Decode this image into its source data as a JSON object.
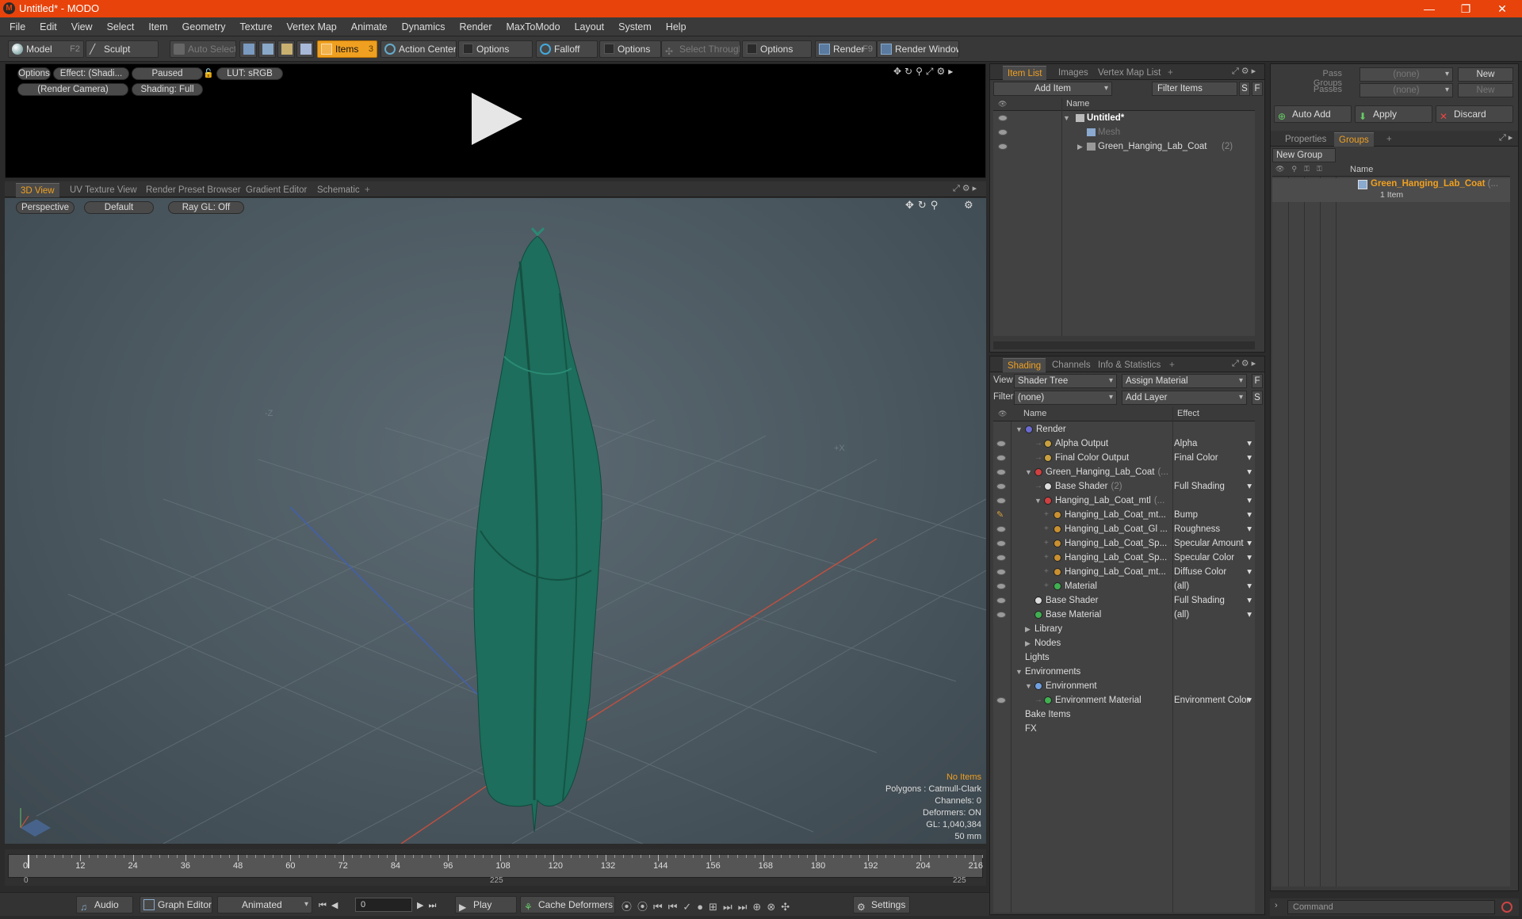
{
  "app": {
    "logo": "M",
    "title": "Untitled* - MODO",
    "min": "—",
    "max": "❐",
    "close": "✕"
  },
  "menu": [
    "File",
    "Edit",
    "View",
    "Select",
    "Item",
    "Geometry",
    "Texture",
    "Vertex Map",
    "Animate",
    "Dynamics",
    "Render",
    "MaxToModo",
    "Layout",
    "System",
    "Help"
  ],
  "toolbar": {
    "model": "Model",
    "model_key": "F2",
    "sculpt": "Sculpt",
    "auto_select": "Auto Select",
    "items": "Items",
    "items_key": "3",
    "action_center": "Action Center",
    "options1": "Options",
    "falloff": "Falloff",
    "options2": "Options",
    "select_through": "Select Through",
    "options3": "Options",
    "render": "Render",
    "render_key": "F9",
    "render_window": "Render Window"
  },
  "preview": {
    "options": "Options",
    "effect": "Effect: (Shadi...",
    "paused": "Paused",
    "lut": "LUT: sRGB",
    "camera": "(Render Camera)",
    "shading": "Shading: Full"
  },
  "viewtabs": [
    "3D View",
    "UV Texture View",
    "Render Preset Browser",
    "Gradient Editor",
    "Schematic"
  ],
  "viewport": {
    "perspective": "Perspective",
    "default": "Default",
    "raygl": "Ray GL: Off",
    "axis_z": "-Z",
    "axis_x": "+X",
    "info": {
      "no_items": "No Items",
      "polygons": "Polygons : Catmull-Clark",
      "channels": "Channels: 0",
      "deformers": "Deformers: ON",
      "gl": "GL: 1,040,384",
      "focal": "50 mm"
    }
  },
  "timeline": {
    "ticks": [
      "0",
      "12",
      "24",
      "36",
      "48",
      "60",
      "72",
      "84",
      "96",
      "108",
      "120",
      "132",
      "144",
      "156",
      "168",
      "180",
      "192",
      "204",
      "216"
    ],
    "start": "0",
    "mid": "225",
    "end": "225"
  },
  "bottombar": {
    "audio": "Audio",
    "graph_editor": "Graph Editor",
    "animated": "Animated",
    "frame": "0",
    "play": "Play",
    "cache_deformers": "Cache Deformers",
    "settings": "Settings"
  },
  "itemlist": {
    "tabs": [
      "Item List",
      "Images",
      "Vertex Map List"
    ],
    "add_item": "Add Item",
    "filter_items": "Filter Items",
    "s": "S",
    "f": "F",
    "col_name": "Name",
    "rows": [
      {
        "name": "Untitled*",
        "level": 0,
        "bold": true,
        "eye": true
      },
      {
        "name": "Mesh",
        "level": 1,
        "dim": true,
        "eye": true
      },
      {
        "name": "Green_Hanging_Lab_Coat",
        "count": "(2)",
        "level": 1,
        "eye": true
      }
    ]
  },
  "shading": {
    "tabs": [
      "Shading",
      "Channels",
      "Info & Statistics"
    ],
    "view_label": "View",
    "view_value": "Shader Tree",
    "assign_material": "Assign Material",
    "f": "F",
    "filter_label": "Filter",
    "filter_value": "(none)",
    "add_layer": "Add Layer",
    "s": "S",
    "col_name": "Name",
    "col_effect": "Effect",
    "rows": [
      {
        "name": "Render",
        "indent": 0,
        "icon": "#6a6ad0",
        "effect": "",
        "eye": false,
        "exp": "▼"
      },
      {
        "name": "Alpha Output",
        "indent": 2,
        "icon": "#c8a040",
        "effect": "Alpha",
        "eye": true,
        "arr": true
      },
      {
        "name": "Final Color Output",
        "indent": 2,
        "icon": "#c8a040",
        "effect": "Final Color",
        "eye": true,
        "arr": true
      },
      {
        "name": "Green_Hanging_Lab_Coat",
        "suffix": "(...",
        "indent": 1,
        "icon": "#d04040",
        "effect": "",
        "eye": true,
        "exp": "▼",
        "arr": true
      },
      {
        "name": "Base Shader",
        "suffix": "(2)",
        "indent": 2,
        "icon": "#dddddd",
        "effect": "Full Shading",
        "eye": true,
        "arr": true
      },
      {
        "name": "Hanging_Lab_Coat_mtl",
        "suffix": "(...",
        "indent": 2,
        "icon": "#d04040",
        "effect": "",
        "eye": true,
        "exp": "▼",
        "arr": true
      },
      {
        "name": "Hanging_Lab_Coat_mt...",
        "indent": 3,
        "icon": "#c89030",
        "effect": "Bump",
        "eye": false,
        "brush": true,
        "arr": true
      },
      {
        "name": "Hanging_Lab_Coat_Gl ...",
        "indent": 3,
        "icon": "#c89030",
        "effect": "Roughness",
        "eye": true,
        "arr": true
      },
      {
        "name": "Hanging_Lab_Coat_Sp...",
        "indent": 3,
        "icon": "#c89030",
        "effect": "Specular Amount",
        "eye": true,
        "arr": true
      },
      {
        "name": "Hanging_Lab_Coat_Sp...",
        "indent": 3,
        "icon": "#c89030",
        "effect": "Specular Color",
        "eye": true,
        "arr": true
      },
      {
        "name": "Hanging_Lab_Coat_mt...",
        "indent": 3,
        "icon": "#c89030",
        "effect": "Diffuse Color",
        "eye": true,
        "arr": true
      },
      {
        "name": "Material",
        "indent": 3,
        "icon": "#40b050",
        "effect": "(all)",
        "eye": true,
        "arr": true
      },
      {
        "name": "Base Shader",
        "indent": 1,
        "icon": "#dddddd",
        "effect": "Full Shading",
        "eye": true,
        "arr": true
      },
      {
        "name": "Base Material",
        "indent": 1,
        "icon": "#40b050",
        "effect": "(all)",
        "eye": true,
        "arr": true
      },
      {
        "name": "Library",
        "indent": 1,
        "icon": "",
        "effect": "",
        "eye": false,
        "exp": "▶"
      },
      {
        "name": "Nodes",
        "indent": 1,
        "icon": "",
        "effect": "",
        "eye": false,
        "exp": "▶"
      },
      {
        "name": "Lights",
        "indent": 0,
        "icon": "",
        "effect": "",
        "eye": false
      },
      {
        "name": "Environments",
        "indent": 0,
        "icon": "",
        "effect": "",
        "eye": false,
        "exp": "▼"
      },
      {
        "name": "Environment",
        "indent": 1,
        "icon": "#70a0e0",
        "effect": "",
        "eye": false,
        "exp": "▼"
      },
      {
        "name": "Environment Material",
        "indent": 2,
        "icon": "#40b050",
        "effect": "Environment Color",
        "eye": true,
        "arr": true
      },
      {
        "name": "Bake Items",
        "indent": 0,
        "icon": "",
        "effect": "",
        "eye": false
      },
      {
        "name": "FX",
        "indent": 0,
        "icon": "",
        "effect": "",
        "eye": false
      }
    ]
  },
  "rightpanel": {
    "pass_groups": "Pass Groups",
    "pass_value": "(none)",
    "new1": "New",
    "passes": "Passes",
    "passes_value": "(none)",
    "new2": "New",
    "auto_add": "Auto Add",
    "apply": "Apply",
    "discard": "Discard",
    "tabs": [
      "Properties",
      "Groups"
    ],
    "new_group": "New Group",
    "col_name": "Name",
    "group_name": "Green_Hanging_Lab_Coat",
    "group_suffix": "(...",
    "group_count": "1 Item",
    "command": "Command"
  },
  "colors": {
    "accent": "#f0a020",
    "title": "#e8430b",
    "coat": "#1d6e5c"
  }
}
